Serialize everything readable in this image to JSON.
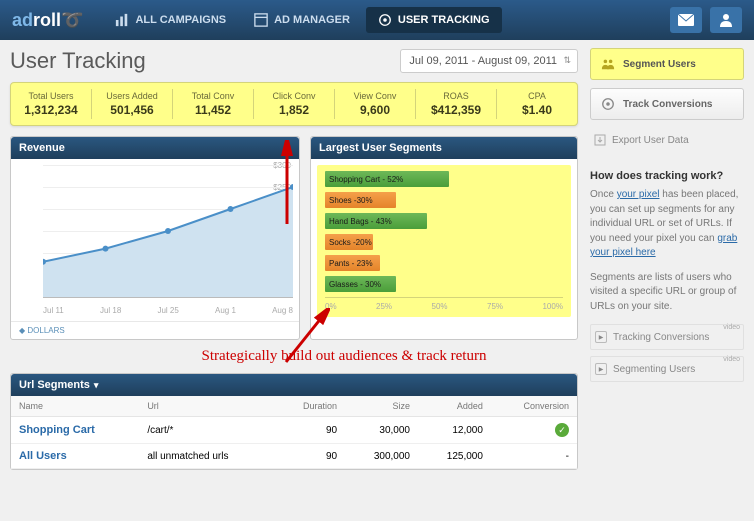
{
  "header": {
    "logo_parts": {
      "ad": "ad",
      "roll": "roll"
    },
    "nav": [
      {
        "label": "All Campaigns"
      },
      {
        "label": "Ad Manager"
      },
      {
        "label": "User Tracking"
      }
    ]
  },
  "page_title": "User Tracking",
  "date_range": "Jul 09, 2011 - August 09, 2011",
  "stats": [
    {
      "label": "Total Users",
      "value": "1,312,234"
    },
    {
      "label": "Users Added",
      "value": "501,456"
    },
    {
      "label": "Total Conv",
      "value": "11,452"
    },
    {
      "label": "Click Conv",
      "value": "1,852"
    },
    {
      "label": "View Conv",
      "value": "9,600"
    },
    {
      "label": "ROAS",
      "value": "$412,359"
    },
    {
      "label": "CPA",
      "value": "$1.40"
    }
  ],
  "revenue_panel": {
    "title": "Revenue",
    "footer": "Dollars"
  },
  "segments_panel": {
    "title": "Largest User Segments"
  },
  "chart_data": [
    {
      "type": "line",
      "title": "Revenue",
      "xlabel": "",
      "ylabel": "",
      "ylim": [
        0,
        300
      ],
      "yticks": [
        50,
        100,
        150,
        200,
        250,
        300
      ],
      "categories": [
        "Jul 11",
        "Jul 18",
        "Jul 25",
        "Aug 1",
        "Aug 8"
      ],
      "values": [
        80,
        110,
        150,
        200,
        250
      ]
    },
    {
      "type": "bar",
      "title": "Largest User Segments",
      "orientation": "horizontal",
      "xlabel": "",
      "ylabel": "",
      "xlim": [
        0,
        100
      ],
      "xticks": [
        0,
        25,
        50,
        75,
        100
      ],
      "series": [
        {
          "name": "Shopping Cart",
          "value": 52,
          "color": "green"
        },
        {
          "name": "Shoes",
          "value": 30,
          "color": "orange",
          "suffix": "-30%"
        },
        {
          "name": "Hand Bags",
          "value": 43,
          "color": "green"
        },
        {
          "name": "Socks",
          "value": 20,
          "color": "orange",
          "suffix": "-20%"
        },
        {
          "name": "Pants",
          "value": 23,
          "color": "orange"
        },
        {
          "name": "Glasses",
          "value": 30,
          "color": "green"
        }
      ]
    }
  ],
  "annotation_text": "Strategically build out audiences & track return",
  "table": {
    "title": "Url Segments",
    "columns": [
      "Name",
      "Url",
      "Duration",
      "Size",
      "Added",
      "Conversion"
    ],
    "rows": [
      {
        "name": "Shopping Cart",
        "url": "/cart/*",
        "duration": "90",
        "size": "30,000",
        "added": "12,000",
        "conv": true
      },
      {
        "name": "All Users",
        "url": "all unmatched urls",
        "duration": "90",
        "size": "300,000",
        "added": "125,000",
        "conv": false
      }
    ]
  },
  "sidebar": {
    "segment_btn": "Segment Users",
    "track_btn": "Track Conversions",
    "export": "Export User Data",
    "help_title": "How does tracking work?",
    "help_1a": "Once ",
    "help_link1": "your pixel",
    "help_1b": " has been placed, you can set up segments for any individual URL or set of URLs. If you need your pixel you can ",
    "help_link2": "grab your pixel here",
    "help_2": "Segments are lists of users who visited a specific URL or group of URLs on your site.",
    "video1": "Tracking Conversions",
    "video2": "Segmenting Users",
    "video_badge": "video"
  }
}
